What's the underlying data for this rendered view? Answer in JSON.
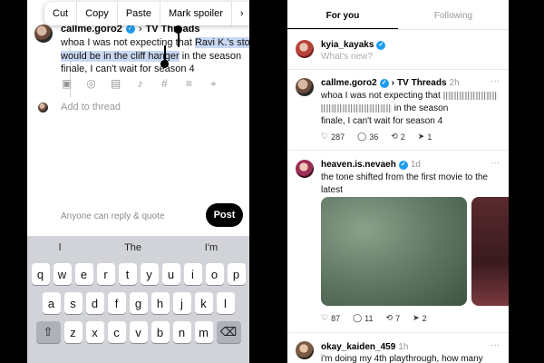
{
  "left": {
    "context_menu": [
      "Cut",
      "Copy",
      "Paste",
      "Mark spoiler"
    ],
    "context_more": "›",
    "compose": {
      "username": "callme.goro2",
      "topic": "TV Threads",
      "text_before": "whoa I was not expecting that ",
      "text_selected": "Ravi K.'s story would be in the cliff hanger",
      "text_after": " in the season finale, I can't wait for season 4"
    },
    "tool_icons": [
      "gallery-icon",
      "camera-icon",
      "gif-icon",
      "mic-icon",
      "hashtag-icon",
      "list-icon",
      "location-icon"
    ],
    "tool_glyphs": [
      "▣",
      "◎",
      "▤",
      "♪",
      "#",
      "≡",
      "⌖"
    ],
    "add_to_thread": "Add to thread",
    "reply_option": "Anyone can reply & quote",
    "post_button": "Post",
    "keyboard": {
      "suggestions": [
        "l",
        "The",
        "I'm"
      ],
      "row1": [
        "q",
        "w",
        "e",
        "r",
        "t",
        "y",
        "u",
        "i",
        "o",
        "p"
      ],
      "row2": [
        "a",
        "s",
        "d",
        "f",
        "g",
        "h",
        "j",
        "k",
        "l"
      ],
      "row3": [
        "z",
        "x",
        "c",
        "v",
        "b",
        "n",
        "m"
      ],
      "shift_glyph": "⇧",
      "backspace_glyph": "⌫"
    }
  },
  "right": {
    "tabs": [
      "For you",
      "Following"
    ],
    "composer": {
      "username": "kyia_kayaks",
      "placeholder": "What's new?"
    },
    "posts": [
      {
        "username": "callme.goro2",
        "topic": "TV Threads",
        "time": "2h",
        "line1_start": "whoa I was not expecting that",
        "line2_end": "in the season",
        "line3": "finale, I can't wait for season 4",
        "likes": "287",
        "replies": "36",
        "reposts": "2",
        "shares": "1"
      },
      {
        "username": "heaven.is.nevaeh",
        "time": "1d",
        "text": "the tone shifted from the first movie to the latest",
        "likes": "87",
        "replies": "11",
        "reposts": "7",
        "shares": "2"
      },
      {
        "username": "okay_kaiden_459",
        "time": "1h",
        "text": "i'm doing my 4th playthrough, how many"
      }
    ],
    "more_glyph": "···"
  },
  "colors": {
    "accent": "#1d9bf0",
    "selection": "#c9d8f2",
    "keyboard": "#d1d3d9"
  }
}
